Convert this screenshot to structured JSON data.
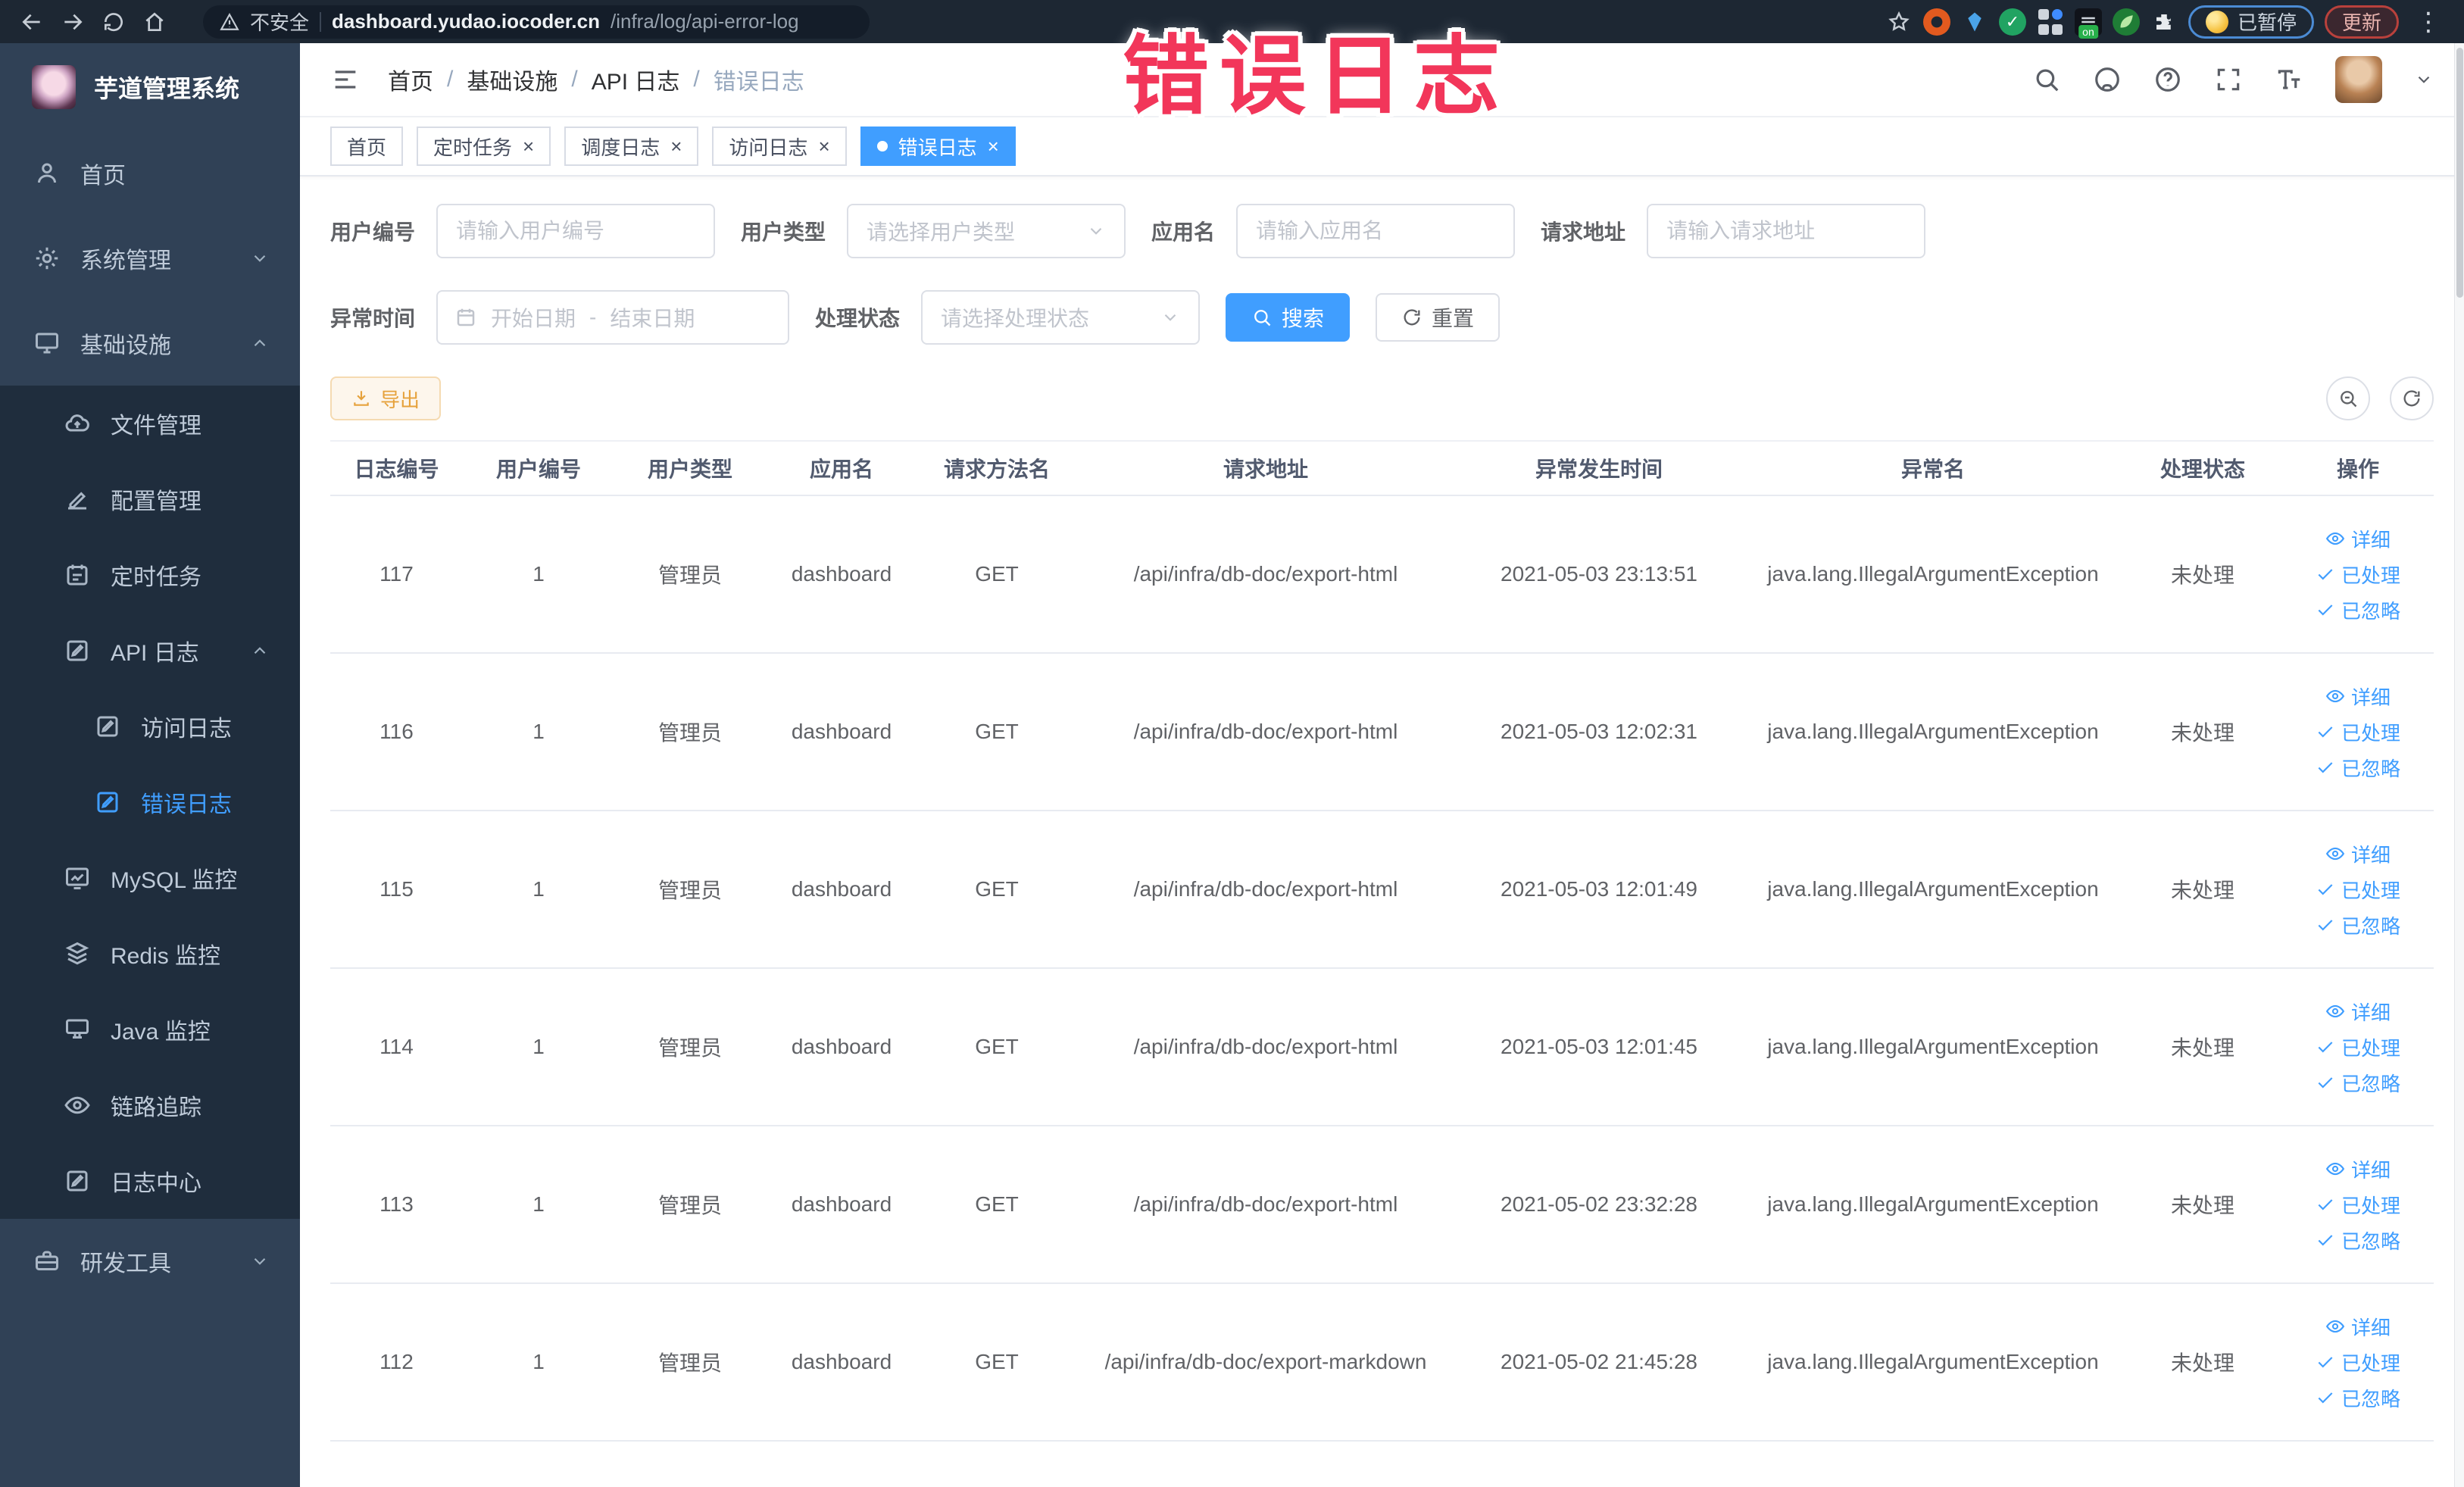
{
  "browser": {
    "security_label": "不安全",
    "url_host": "dashboard.yudao.iocoder.cn",
    "url_path": "/infra/log/api-error-log",
    "paused_label": "已暂停",
    "update_label": "更新"
  },
  "overlay": {
    "text": "错误日志",
    "color": "#f2365a"
  },
  "colors": {
    "accent": "#409eff",
    "warning": "#e6a23c",
    "sidebar_bg": "#304156",
    "submenu_bg": "#1f2d3d"
  },
  "sidebar": {
    "title": "芋道管理系统",
    "items": [
      {
        "label": "首页",
        "icon": "user",
        "level": 1
      },
      {
        "label": "系统管理",
        "icon": "gear",
        "level": 1,
        "chevron": "down"
      },
      {
        "label": "基础设施",
        "icon": "monitor",
        "level": 1,
        "chevron": "up"
      },
      {
        "label": "文件管理",
        "icon": "cloud",
        "level": 2
      },
      {
        "label": "配置管理",
        "icon": "edit",
        "level": 2
      },
      {
        "label": "定时任务",
        "icon": "task",
        "level": 2
      },
      {
        "label": "API 日志",
        "icon": "log",
        "level": 2,
        "chevron": "up"
      },
      {
        "label": "访问日志",
        "icon": "log",
        "level": 3
      },
      {
        "label": "错误日志",
        "icon": "log",
        "level": 3,
        "active": true
      },
      {
        "label": "MySQL 监控",
        "icon": "chart",
        "level": 2
      },
      {
        "label": "Redis 监控",
        "icon": "layers",
        "level": 2
      },
      {
        "label": "Java 监控",
        "icon": "pc",
        "level": 2
      },
      {
        "label": "链路追踪",
        "icon": "eye",
        "level": 2
      },
      {
        "label": "日志中心",
        "icon": "log",
        "level": 2
      },
      {
        "label": "研发工具",
        "icon": "tool",
        "level": 1,
        "chevron": "down"
      }
    ]
  },
  "breadcrumb": {
    "items": [
      "首页",
      "基础设施",
      "API 日志",
      "错误日志"
    ]
  },
  "tabs": [
    {
      "label": "首页",
      "closable": false,
      "active": false
    },
    {
      "label": "定时任务",
      "closable": true,
      "active": false
    },
    {
      "label": "调度日志",
      "closable": true,
      "active": false
    },
    {
      "label": "访问日志",
      "closable": true,
      "active": false
    },
    {
      "label": "错误日志",
      "closable": true,
      "active": true
    }
  ],
  "filters": {
    "user_id": {
      "label": "用户编号",
      "placeholder": "请输入用户编号"
    },
    "user_type": {
      "label": "用户类型",
      "placeholder": "请选择用户类型"
    },
    "app_name": {
      "label": "应用名",
      "placeholder": "请输入应用名"
    },
    "request_url": {
      "label": "请求地址",
      "placeholder": "请输入请求地址"
    },
    "exception_time": {
      "label": "异常时间",
      "start_placeholder": "开始日期",
      "separator": "-",
      "end_placeholder": "结束日期"
    },
    "process_status": {
      "label": "处理状态",
      "placeholder": "请选择处理状态"
    },
    "search_label": "搜索",
    "reset_label": "重置"
  },
  "toolbar": {
    "export_label": "导出"
  },
  "table": {
    "headers": [
      "日志编号",
      "用户编号",
      "用户类型",
      "应用名",
      "请求方法名",
      "请求地址",
      "异常发生时间",
      "异常名",
      "处理状态",
      "操作"
    ],
    "row_actions": [
      "详细",
      "已处理",
      "已忽略"
    ],
    "rows": [
      [
        "117",
        "1",
        "管理员",
        "dashboard",
        "GET",
        "/api/infra/db-doc/export-html",
        "2021-05-03 23:13:51",
        "java.lang.IllegalArgumentException",
        "未处理"
      ],
      [
        "116",
        "1",
        "管理员",
        "dashboard",
        "GET",
        "/api/infra/db-doc/export-html",
        "2021-05-03 12:02:31",
        "java.lang.IllegalArgumentException",
        "未处理"
      ],
      [
        "115",
        "1",
        "管理员",
        "dashboard",
        "GET",
        "/api/infra/db-doc/export-html",
        "2021-05-03 12:01:49",
        "java.lang.IllegalArgumentException",
        "未处理"
      ],
      [
        "114",
        "1",
        "管理员",
        "dashboard",
        "GET",
        "/api/infra/db-doc/export-html",
        "2021-05-03 12:01:45",
        "java.lang.IllegalArgumentException",
        "未处理"
      ],
      [
        "113",
        "1",
        "管理员",
        "dashboard",
        "GET",
        "/api/infra/db-doc/export-html",
        "2021-05-02 23:32:28",
        "java.lang.IllegalArgumentException",
        "未处理"
      ],
      [
        "112",
        "1",
        "管理员",
        "dashboard",
        "GET",
        "/api/infra/db-doc/export-markdown",
        "2021-05-02 21:45:28",
        "java.lang.IllegalArgumentException",
        "未处理"
      ]
    ]
  }
}
